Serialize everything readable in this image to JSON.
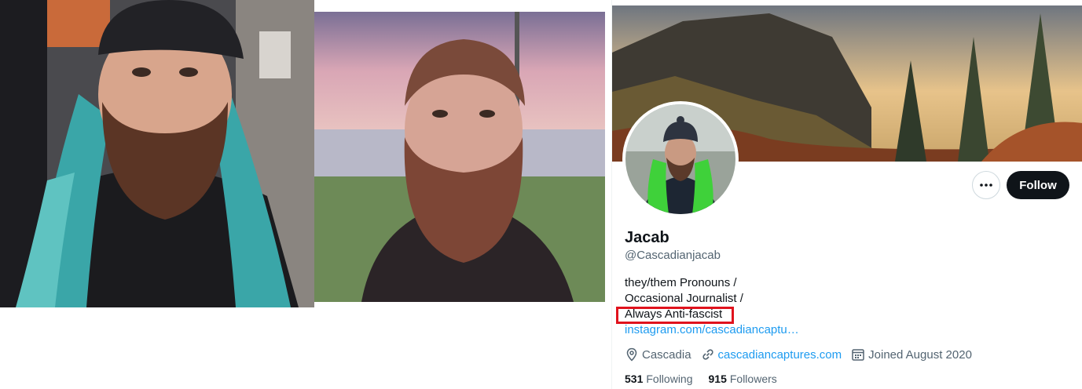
{
  "profile": {
    "display_name": "Jacab",
    "handle": "@Cascadianjacab",
    "bio_lines": [
      "they/them Pronouns /",
      "Occasional Journalist /",
      "Always Anti-fascist"
    ],
    "bio_link": "instagram.com/cascadiancaptu…",
    "location": "Cascadia",
    "website": "cascadiancaptures.com",
    "joined": "Joined August 2020",
    "following_count": "531",
    "following_label": "Following",
    "followers_count": "915",
    "followers_label": "Followers",
    "follow_label": "Follow"
  },
  "icons": {
    "more": "more-horizontal-icon",
    "location": "location-pin-icon",
    "website": "link-icon",
    "joined": "calendar-icon"
  },
  "colors": {
    "follow_button": "#0f1419",
    "link": "#1d9bf0",
    "highlight": "#e0131d",
    "secondary_text": "#536471"
  }
}
